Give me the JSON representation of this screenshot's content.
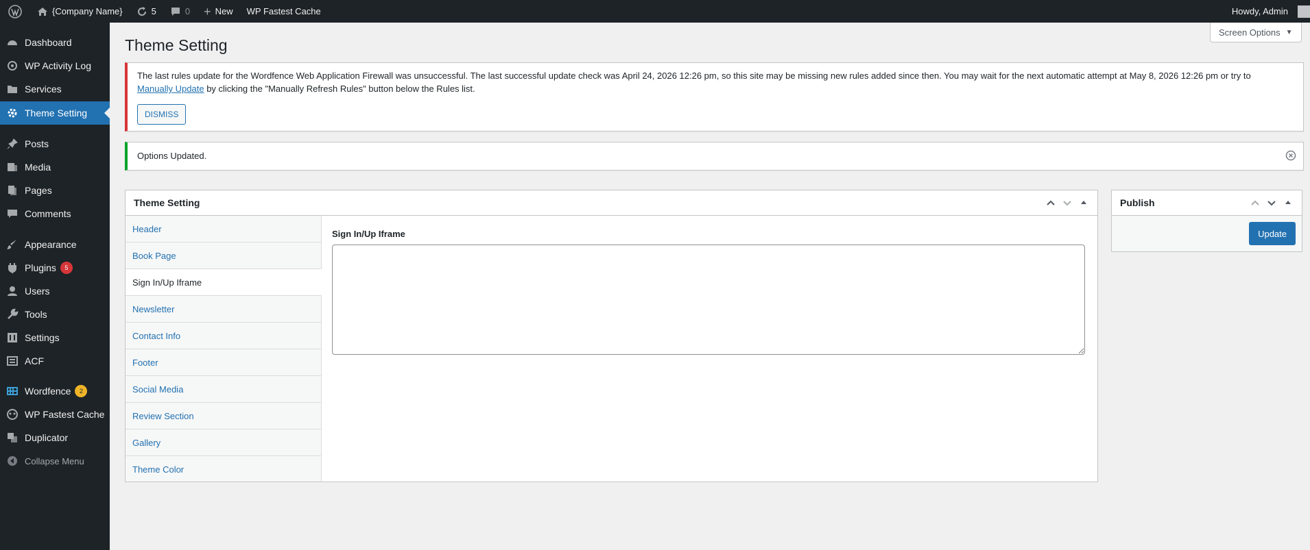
{
  "adminbar": {
    "site_name": "{Company Name}",
    "updates_count": "5",
    "comments_count": "0",
    "new_label": "New",
    "cache_label": "WP Fastest Cache",
    "howdy": "Howdy, Admin"
  },
  "sidebar": {
    "items": [
      {
        "label": "Dashboard",
        "icon": "dashboard-icon"
      },
      {
        "label": "WP Activity Log",
        "icon": "activity-log-icon"
      },
      {
        "label": "Services",
        "icon": "folder-icon"
      },
      {
        "label": "Theme Setting",
        "icon": "gear-icon"
      },
      {
        "label": "Posts",
        "icon": "pin-icon"
      },
      {
        "label": "Media",
        "icon": "media-icon"
      },
      {
        "label": "Pages",
        "icon": "pages-icon"
      },
      {
        "label": "Comments",
        "icon": "comment-icon"
      },
      {
        "label": "Appearance",
        "icon": "brush-icon"
      },
      {
        "label": "Plugins",
        "icon": "plugin-icon",
        "badge": "5"
      },
      {
        "label": "Users",
        "icon": "user-icon"
      },
      {
        "label": "Tools",
        "icon": "wrench-icon"
      },
      {
        "label": "Settings",
        "icon": "settings-icon"
      },
      {
        "label": "ACF",
        "icon": "acf-icon"
      },
      {
        "label": "Wordfence",
        "icon": "wordfence-icon",
        "badge": "2"
      },
      {
        "label": "WP Fastest Cache",
        "icon": "cheetah-icon"
      },
      {
        "label": "Duplicator",
        "icon": "duplicator-icon"
      },
      {
        "label": "Collapse Menu",
        "icon": "collapse-icon"
      }
    ]
  },
  "page": {
    "title": "Theme Setting",
    "screen_options": "Screen Options"
  },
  "notices": {
    "error_text": "The last rules update for the Wordfence Web Application Firewall was unsuccessful. The last successful update check was April 24, 2026 12:26 pm, so this site may be missing new rules added since then. You may wait for the next automatic attempt at May 8, 2026 12:26 pm or try to",
    "error_link": "Manually Update",
    "error_text_after": "by clicking the \"Manually Refresh Rules\" button below the Rules list.",
    "dismiss_label": "DISMISS",
    "success_text": "Options Updated."
  },
  "theme_box": {
    "title": "Theme Setting",
    "tabs": [
      "Header",
      "Book Page",
      "Sign In/Up Iframe",
      "Newsletter",
      "Contact Info",
      "Footer",
      "Social Media",
      "Review Section",
      "Gallery",
      "Theme Color"
    ],
    "active_tab": "Sign In/Up Iframe",
    "field_label": "Sign In/Up Iframe",
    "field_value": ""
  },
  "publish_box": {
    "title": "Publish",
    "update_label": "Update"
  },
  "colors": {
    "accent": "#2271b1",
    "admin_dark": "#1d2327",
    "error": "#d63638",
    "success": "#00a32a"
  }
}
